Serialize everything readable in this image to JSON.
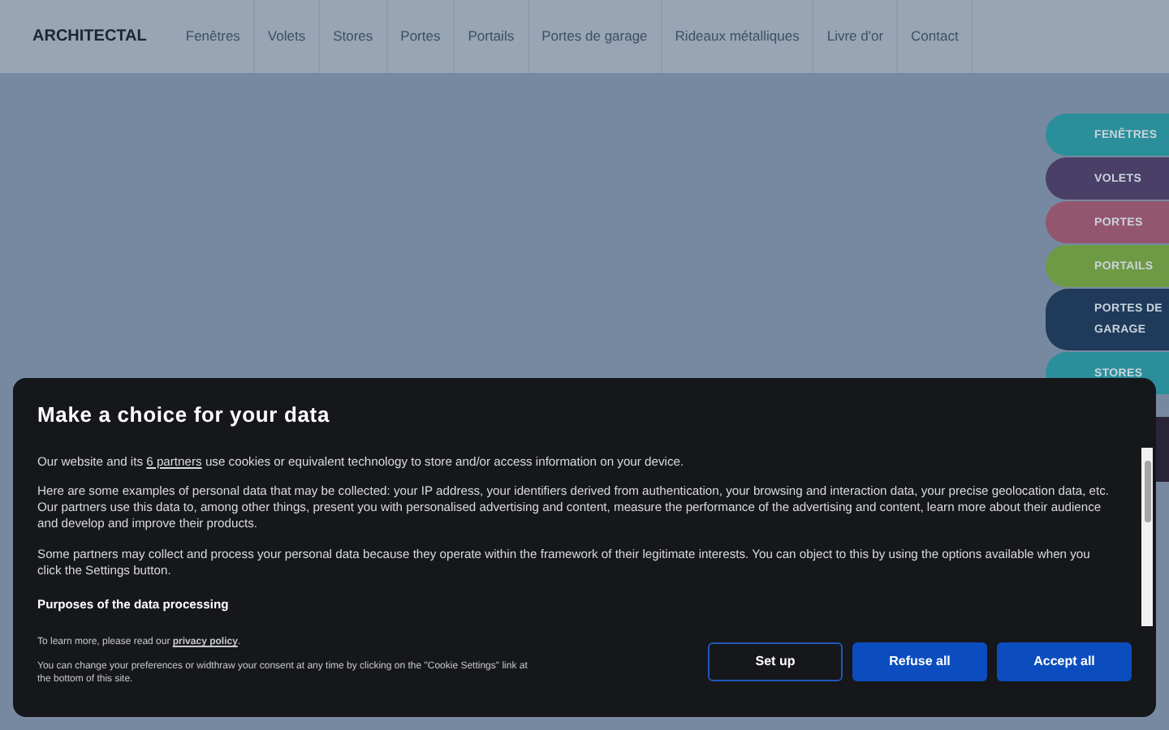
{
  "header": {
    "logo": "ARCHITECTAL",
    "nav": [
      {
        "label": "Fenêtres"
      },
      {
        "label": "Volets"
      },
      {
        "label": "Stores"
      },
      {
        "label": "Portes"
      },
      {
        "label": "Portails"
      },
      {
        "label": "Portes de garage"
      },
      {
        "label": "Rideaux métalliques"
      },
      {
        "label": "Livre d'or"
      },
      {
        "label": "Contact"
      }
    ]
  },
  "side_tabs": [
    {
      "label": "FENÊTRES",
      "color": "#2a8f9a"
    },
    {
      "label": "VOLETS",
      "color": "#4a3f66"
    },
    {
      "label": "PORTES",
      "color": "#94566e"
    },
    {
      "label": "PORTAILS",
      "color": "#6f9a45"
    },
    {
      "label": "PORTES DE GARAGE",
      "color": "#1f3a5a"
    },
    {
      "label": "STORES",
      "color": "#2a8f9a"
    }
  ],
  "consent": {
    "title": "Make a choice for your data",
    "intro": {
      "before": "Our website and its",
      "link": "6 partners",
      "after": "use cookies or equivalent technology to store and/or access information on your device."
    },
    "paragraphs": [
      "Here are some examples of personal data that may be collected: your IP address, your identifiers derived from authentication, your browsing and interaction data, your precise geolocation data, etc.",
      "Our partners use this data to, among other things, present you with personalised advertising and content, measure the performance of the advertising and content, learn more about their audience and develop and improve their products."
    ],
    "legitimate": "Some partners may collect and process your personal data because they operate within the framework of their legitimate interests. You can object to this by using the options available when you click the Settings button.",
    "purposes_heading": "Purposes of the data processing",
    "learn_more": {
      "before": "To learn more, please read our",
      "link": "privacy policy",
      "after": "."
    },
    "change_note": "You can change your preferences or widthraw your consent at any time by clicking on the \"Cookie Settings\" link at the bottom of this site.",
    "buttons": [
      {
        "label": "Set up",
        "kind": "outline"
      },
      {
        "label": "Refuse all",
        "kind": "filled"
      },
      {
        "label": "Accept all",
        "kind": "filled"
      }
    ]
  }
}
